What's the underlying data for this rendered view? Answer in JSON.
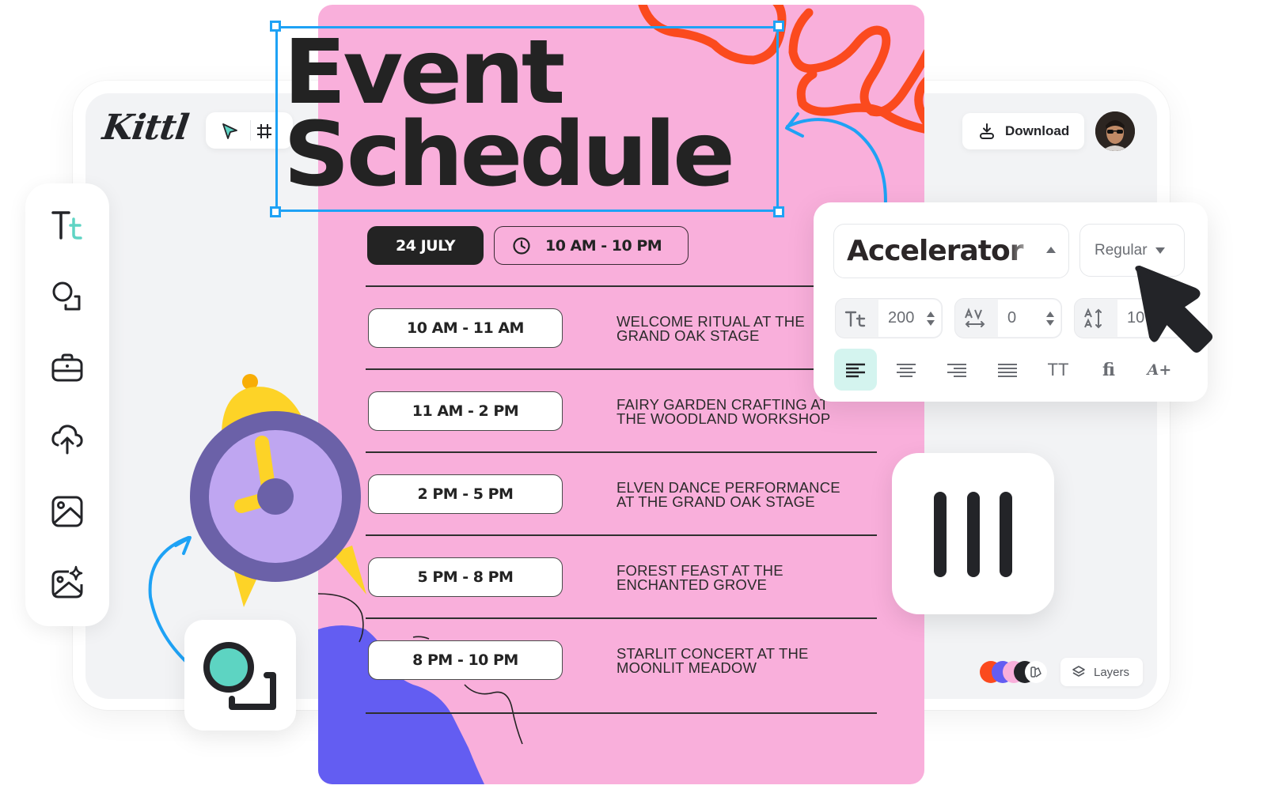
{
  "app": {
    "logo": "Kittl",
    "download_label": "Download",
    "layers_label": "Layers"
  },
  "toolbar": {
    "tools": [
      {
        "name": "select",
        "icon": "cursor-arrow-icon",
        "active": true
      },
      {
        "name": "frame",
        "icon": "frame-hash-icon",
        "active": false
      }
    ]
  },
  "sidebar": {
    "items": [
      {
        "id": "text",
        "icon": "text-tool-icon"
      },
      {
        "id": "elements",
        "icon": "shapes-icon"
      },
      {
        "id": "templates",
        "icon": "briefcase-icon"
      },
      {
        "id": "uploads",
        "icon": "cloud-upload-icon"
      },
      {
        "id": "photos",
        "icon": "image-icon"
      },
      {
        "id": "ai-images",
        "icon": "ai-image-sparkle-icon"
      }
    ]
  },
  "poster": {
    "title_line1": "Event",
    "title_line2": "Schedule",
    "date": "24 JULY",
    "hours": "10 AM - 10 PM",
    "schedule": [
      {
        "time": "10 AM - 11 AM",
        "event": "WELCOME RITUAL AT THE\nGRAND OAK STAGE"
      },
      {
        "time": "11 AM - 2 PM",
        "event": "FAIRY GARDEN CRAFTING AT\nTHE WOODLAND WORKSHOP"
      },
      {
        "time": "2 PM - 5 PM",
        "event": "ELVEN DANCE PERFORMANCE\nAT THE GRAND OAK STAGE"
      },
      {
        "time": "5 PM - 8 PM",
        "event": "FOREST FEAST AT THE\nENCHANTED GROVE"
      },
      {
        "time": "8 PM - 10 PM",
        "event": "STARLIT CONCERT AT THE\nMOONLIT MEADOW"
      }
    ],
    "colors": {
      "background": "#f9afdb",
      "squiggle": "#fb4a1e",
      "blob": "#635df2",
      "ink": "#232323"
    }
  },
  "font_panel": {
    "font_family": "Accelerator",
    "font_weight": "Regular",
    "font_size": "200",
    "letter_spacing": "0",
    "line_height": "10",
    "alignment_options": [
      {
        "id": "align-left",
        "label": "",
        "active": true
      },
      {
        "id": "align-center",
        "label": "",
        "active": false
      },
      {
        "id": "align-right",
        "label": "",
        "active": false
      },
      {
        "id": "align-justify",
        "label": "",
        "active": false
      },
      {
        "id": "uppercase",
        "label": "TT",
        "active": false
      },
      {
        "id": "ligatures",
        "label": "fi",
        "active": false
      },
      {
        "id": "font-effects",
        "label": "A+",
        "active": false
      }
    ]
  },
  "palette": {
    "swatches": [
      "#fb4a1e",
      "#635df2",
      "#f9afdb",
      "#232428"
    ]
  },
  "accent_color": "#1ea2f5"
}
